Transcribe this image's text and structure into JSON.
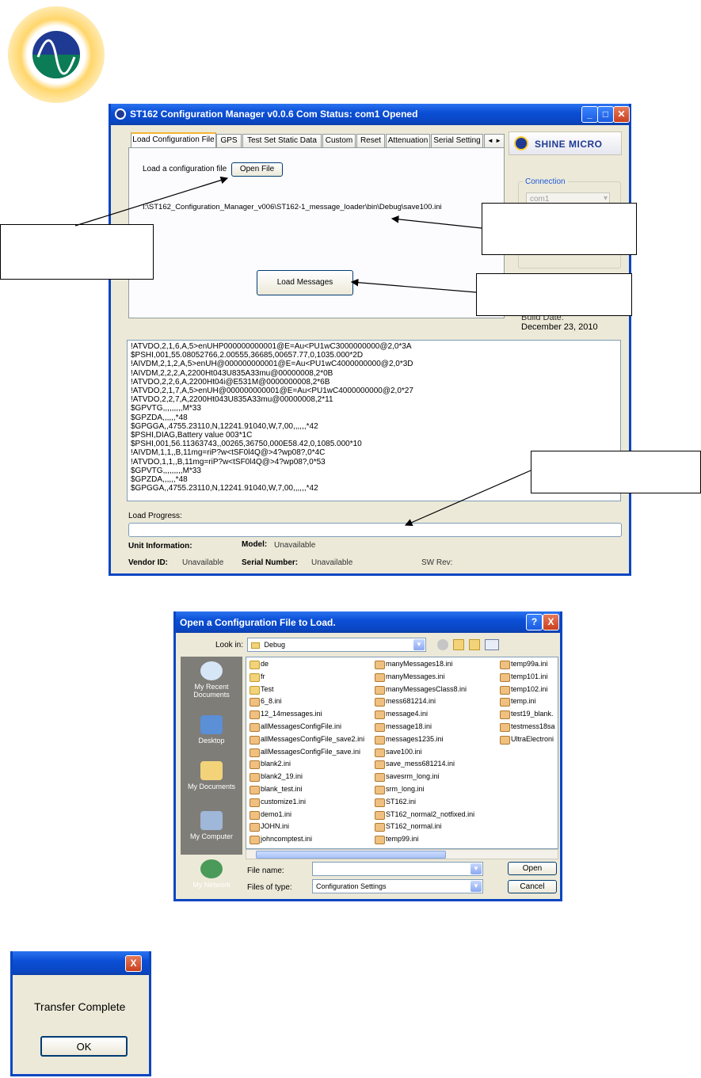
{
  "main_window": {
    "title": "ST162 Configuration Manager v0.0.6   Com Status: com1 Opened",
    "controls": [
      "_",
      "□",
      "X"
    ],
    "tabs": [
      "Load Configuration File",
      "GPS",
      "Test Set Static Data",
      "Custom",
      "Reset",
      "Attenuation",
      "Serial Setting"
    ],
    "tab_scroll": "◄ ►",
    "load_label": "Load a configuration file",
    "open_file_label": "Open File",
    "file_path": "I:\\ST162_Configuration_Manager_v006\\ST162-1_message_loader\\bin\\Debug\\save100.ini",
    "load_messages_label": "Load Messages",
    "brand": "SHINE MICRO",
    "connection_legend": "Connection",
    "connection_value": "com1",
    "build_date_label": "Build Date:",
    "build_date": "December 23, 2010",
    "log_lines": [
      "!ATVDO,2,1,6,A,5>enUHP000000000001@E=Au<PU1wC3000000000@2,0*3A",
      "$PSHI,001,55.08052766,2.00555,36685,00657.77,0,1035.000*2D",
      "!AIVDM,2,1,2,A,5>enUH@000000000001@E=Au<PU1wC4000000000@2,0*3D",
      "!AIVDM,2,2,2,A,2200Ht043U835A33mu@00000008,2*0B",
      "!ATVDO,2,2,6,A,2200Ht04i@E531M@0000000008,2*6B",
      "!ATVDO,2,1,7,A,5>enUH@000000000001@E=Au<PU1wC4000000000@2,0*27",
      "!ATVDO,2,2,7,A,2200Ht043U835A33mu@00000008,2*11",
      "$GPVTG,,,,,,,,,M*33",
      "$GPZDA,,,,,,*48",
      "$GPGGA,,4755.23110,N,12241.91040,W,7,00,,,,,,*42",
      "$PSHI,DIAG,Battery value 003*1C",
      "$PSHI,001,56.11363743,,00265,36750,000E58.42,0,1085.000*10",
      "!AIVDM,1,1,,B,11mg=riP?w<tSF0l4Q@>4?wp08?,0*4C",
      "!ATVDO,1,1,,B,11mg=riP?w<tSF0l4Q@>4?wp08?,0*53",
      "$GPVTG,,,,,,,,,M*33",
      "$GPZDA,,,,,,*48",
      "$GPGGA,,4755.23110,N,12241.91040,W,7,00,,,,,,*42"
    ],
    "load_progress_label": "Load Progress:",
    "load_progress_value": 0,
    "unit_info_label": "Unit Information:",
    "model_label": "Model:",
    "model_value": "Unavailable",
    "vendor_label": "Vendor ID:",
    "vendor_value": "Unavailable",
    "serial_label": "Serial Number:",
    "serial_value": "Unavailable",
    "sw_rev_label": "SW Rev:"
  },
  "file_dialog": {
    "title": "Open a Configuration File to Load.",
    "help": "?",
    "close": "X",
    "look_in_label": "Look in:",
    "look_in_value": "Debug",
    "places": [
      "My Recent Documents",
      "Desktop",
      "My Documents",
      "My Computer",
      "My Network"
    ],
    "columns": [
      [
        {
          "name": "de",
          "kind": "folder"
        },
        {
          "name": "fr",
          "kind": "folder"
        },
        {
          "name": "Test",
          "kind": "folder"
        },
        {
          "name": "6_8.ini",
          "kind": "ini"
        },
        {
          "name": "12_14messages.ini",
          "kind": "ini"
        },
        {
          "name": "allMessagesConfigFile.ini",
          "kind": "ini"
        },
        {
          "name": "allMessagesConfigFile_save2.ini",
          "kind": "ini"
        },
        {
          "name": "allMessagesConfigFile_save.ini",
          "kind": "ini"
        },
        {
          "name": "blank2.ini",
          "kind": "ini"
        },
        {
          "name": "blank2_19.ini",
          "kind": "ini"
        },
        {
          "name": "blank_test.ini",
          "kind": "ini"
        },
        {
          "name": "customize1.ini",
          "kind": "ini"
        },
        {
          "name": "demo1.ini",
          "kind": "ini"
        },
        {
          "name": "JOHN.ini",
          "kind": "ini"
        },
        {
          "name": "johncomptest.ini",
          "kind": "ini"
        }
      ],
      [
        {
          "name": "manyMessages18.ini",
          "kind": "ini"
        },
        {
          "name": "manyMessages.ini",
          "kind": "ini"
        },
        {
          "name": "manyMessagesClass8.ini",
          "kind": "ini"
        },
        {
          "name": "mess681214.ini",
          "kind": "ini"
        },
        {
          "name": "message4.ini",
          "kind": "ini"
        },
        {
          "name": "message18.ini",
          "kind": "ini"
        },
        {
          "name": "messages1235.ini",
          "kind": "ini"
        },
        {
          "name": "save100.ini",
          "kind": "ini"
        },
        {
          "name": "save_mess681214.ini",
          "kind": "ini"
        },
        {
          "name": "savesrm_long.ini",
          "kind": "ini"
        },
        {
          "name": "srm_long.ini",
          "kind": "ini"
        },
        {
          "name": "ST162.ini",
          "kind": "ini"
        },
        {
          "name": "ST162_normal2_notfixed.ini",
          "kind": "ini"
        },
        {
          "name": "ST162_normal.ini",
          "kind": "ini"
        },
        {
          "name": "temp99.ini",
          "kind": "ini"
        }
      ],
      [
        {
          "name": "temp99a.ini",
          "kind": "ini"
        },
        {
          "name": "temp101.ini",
          "kind": "ini"
        },
        {
          "name": "temp102.ini",
          "kind": "ini"
        },
        {
          "name": "temp.ini",
          "kind": "ini"
        },
        {
          "name": "test19_blank.",
          "kind": "ini"
        },
        {
          "name": "testmess18sa",
          "kind": "ini"
        },
        {
          "name": "UltraElectroni",
          "kind": "ini"
        }
      ]
    ],
    "file_name_label": "File name:",
    "file_name_value": "",
    "file_type_label": "Files of type:",
    "file_type_value": "Configuration Settings",
    "open_label": "Open",
    "cancel_label": "Cancel"
  },
  "transfer_dialog": {
    "close": "X",
    "message": "Transfer Complete",
    "ok_label": "OK"
  }
}
